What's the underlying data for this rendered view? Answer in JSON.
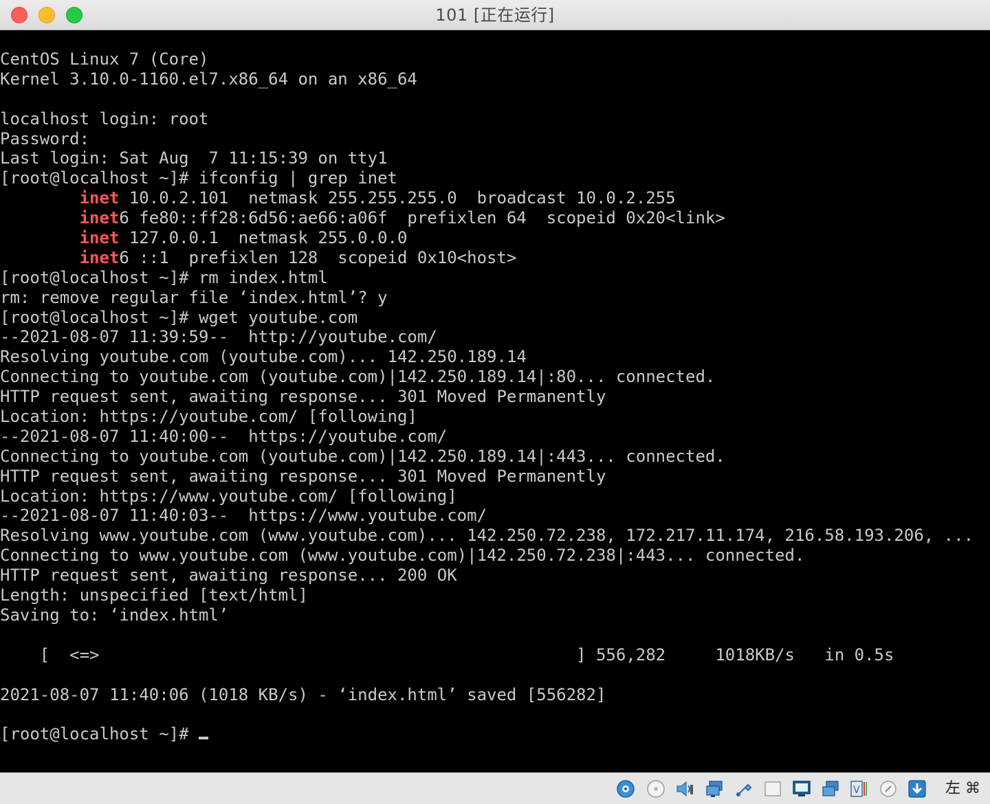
{
  "window": {
    "title": "101 [正在运行]"
  },
  "colors": {
    "terminal_bg": "#000000",
    "terminal_fg": "#c9c9c9",
    "highlight": "#ff5555"
  },
  "terminal": {
    "lines": [
      [
        {
          "t": "CentOS Linux 7 (Core)"
        }
      ],
      [
        {
          "t": "Kernel 3.10.0-1160.el7.x86_64 on an x86_64"
        }
      ],
      [
        {
          "t": ""
        }
      ],
      [
        {
          "t": "localhost login: root"
        }
      ],
      [
        {
          "t": "Password:"
        }
      ],
      [
        {
          "t": "Last login: Sat Aug  7 11:15:39 on tty1"
        }
      ],
      [
        {
          "t": "[root@localhost ~]# ifconfig | grep inet"
        }
      ],
      [
        {
          "t": "        "
        },
        {
          "t": "inet",
          "hl": true
        },
        {
          "t": " 10.0.2.101  netmask 255.255.255.0  broadcast 10.0.2.255"
        }
      ],
      [
        {
          "t": "        "
        },
        {
          "t": "inet",
          "hl": true
        },
        {
          "t": "6 fe80::ff28:6d56:ae66:a06f  prefixlen 64  scopeid 0x20<link>"
        }
      ],
      [
        {
          "t": "        "
        },
        {
          "t": "inet",
          "hl": true
        },
        {
          "t": " 127.0.0.1  netmask 255.0.0.0"
        }
      ],
      [
        {
          "t": "        "
        },
        {
          "t": "inet",
          "hl": true
        },
        {
          "t": "6 ::1  prefixlen 128  scopeid 0x10<host>"
        }
      ],
      [
        {
          "t": "[root@localhost ~]# rm index.html"
        }
      ],
      [
        {
          "t": "rm: remove regular file ‘index.html’? y"
        }
      ],
      [
        {
          "t": "[root@localhost ~]# wget youtube.com"
        }
      ],
      [
        {
          "t": "--2021-08-07 11:39:59--  http://youtube.com/"
        }
      ],
      [
        {
          "t": "Resolving youtube.com (youtube.com)... 142.250.189.14"
        }
      ],
      [
        {
          "t": "Connecting to youtube.com (youtube.com)|142.250.189.14|:80... connected."
        }
      ],
      [
        {
          "t": "HTTP request sent, awaiting response... 301 Moved Permanently"
        }
      ],
      [
        {
          "t": "Location: https://youtube.com/ [following]"
        }
      ],
      [
        {
          "t": "--2021-08-07 11:40:00--  https://youtube.com/"
        }
      ],
      [
        {
          "t": "Connecting to youtube.com (youtube.com)|142.250.189.14|:443... connected."
        }
      ],
      [
        {
          "t": "HTTP request sent, awaiting response... 301 Moved Permanently"
        }
      ],
      [
        {
          "t": "Location: https://www.youtube.com/ [following]"
        }
      ],
      [
        {
          "t": "--2021-08-07 11:40:03--  https://www.youtube.com/"
        }
      ],
      [
        {
          "t": "Resolving www.youtube.com (www.youtube.com)... 142.250.72.238, 172.217.11.174, 216.58.193.206, ..."
        }
      ],
      [
        {
          "t": "Connecting to www.youtube.com (www.youtube.com)|142.250.72.238|:443... connected."
        }
      ],
      [
        {
          "t": "HTTP request sent, awaiting response... 200 OK"
        }
      ],
      [
        {
          "t": "Length: unspecified [text/html]"
        }
      ],
      [
        {
          "t": "Saving to: ‘index.html’"
        }
      ],
      [
        {
          "t": ""
        }
      ],
      [
        {
          "t": "    [  <=>                                                ] 556,282     1018KB/s   in 0.5s"
        }
      ],
      [
        {
          "t": ""
        }
      ],
      [
        {
          "t": "2021-08-07 11:40:06 (1018 KB/s) - ‘index.html’ saved [556282]"
        }
      ],
      [
        {
          "t": ""
        }
      ],
      [
        {
          "t": "[root@localhost ~]# "
        },
        {
          "cursor": true
        }
      ]
    ]
  },
  "statusbar": {
    "icons": [
      "hard-disk-icon",
      "optical-drive-icon",
      "audio-icon",
      "network-icon",
      "usb-icon",
      "shared-folders-icon",
      "display-icon",
      "video-capture-icon",
      "vrde-icon",
      "mouse-integration-icon",
      "keyboard-capture-icon"
    ],
    "host_key": "左 ⌘"
  }
}
